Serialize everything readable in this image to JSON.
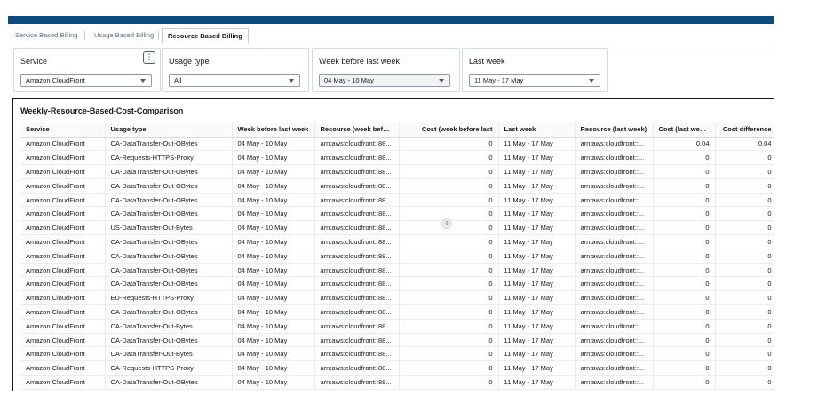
{
  "tabs": [
    {
      "label": "Service Based Billing",
      "active": false
    },
    {
      "label": "Usage Based Billing",
      "active": false
    },
    {
      "label": "Resource Based Billing",
      "active": true
    }
  ],
  "controls": {
    "service": {
      "label": "Service",
      "value": "Amazon CloudFront"
    },
    "usage_type": {
      "label": "Usage type",
      "value": "All"
    },
    "week_before": {
      "label": "Week before last week",
      "value": "04 May - 10 May"
    },
    "last_week": {
      "label": "Last week",
      "value": "11 May - 17 May"
    },
    "kebab_icon": "more-options-icon"
  },
  "table": {
    "title": "Weekly-Resource-Based-Cost-Comparison",
    "columns": [
      "Service",
      "Usage type",
      "Week before last week",
      "Resource (week befor...",
      "Cost (week before last",
      "Last week",
      "Resource (last week)",
      "Cost (last week)",
      "Cost difference"
    ],
    "scroll_bubble": "0",
    "rows": [
      [
        "Amazon CloudFront",
        "CA-DataTransfer-Out-OBytes",
        "04 May - 10 May",
        "arn:aws:cloudfront::88...",
        "0",
        "11 May - 17 May",
        "arn:aws:cloudfront::...",
        "0.04",
        "0.04"
      ],
      [
        "Amazon CloudFront",
        "CA-Requests-HTTPS-Proxy",
        "04 May - 10 May",
        "arn:aws:cloudfront::88...",
        "0",
        "11 May - 17 May",
        "arn:aws:cloudfront::...",
        "0",
        "0"
      ],
      [
        "Amazon CloudFront",
        "CA-DataTransfer-Out-OBytes",
        "04 May - 10 May",
        "arn:aws:cloudfront::88...",
        "0",
        "11 May - 17 May",
        "arn:aws:cloudfront::...",
        "0",
        "0"
      ],
      [
        "Amazon CloudFront",
        "CA-DataTransfer-Out-OBytes",
        "04 May - 10 May",
        "arn:aws:cloudfront::88...",
        "0",
        "11 May - 17 May",
        "arn:aws:cloudfront::...",
        "0",
        "0"
      ],
      [
        "Amazon CloudFront",
        "CA-DataTransfer-Out-OBytes",
        "04 May - 10 May",
        "arn:aws:cloudfront::88...",
        "0",
        "11 May - 17 May",
        "arn:aws:cloudfront::...",
        "0",
        "0"
      ],
      [
        "Amazon CloudFront",
        "CA-DataTransfer-Out-OBytes",
        "04 May - 10 May",
        "arn:aws:cloudfront::88...",
        "0",
        "11 May - 17 May",
        "arn:aws:cloudfront::...",
        "0",
        "0"
      ],
      [
        "Amazon CloudFront",
        "US-DataTransfer-Out-Bytes",
        "04 May - 10 May",
        "arn:aws:cloudfront::88...",
        "0",
        "11 May - 17 May",
        "arn:aws:cloudfront::...",
        "0",
        "0"
      ],
      [
        "Amazon CloudFront",
        "CA-DataTransfer-Out-OBytes",
        "04 May - 10 May",
        "arn:aws:cloudfront::88...",
        "0",
        "11 May - 17 May",
        "arn:aws:cloudfront::...",
        "0",
        "0"
      ],
      [
        "Amazon CloudFront",
        "CA-DataTransfer-Out-OBytes",
        "04 May - 10 May",
        "arn:aws:cloudfront::88...",
        "0",
        "11 May - 17 May",
        "arn:aws:cloudfront::...",
        "0",
        "0"
      ],
      [
        "Amazon CloudFront",
        "CA-DataTransfer-Out-OBytes",
        "04 May - 10 May",
        "arn:aws:cloudfront::88...",
        "0",
        "11 May - 17 May",
        "arn:aws:cloudfront::...",
        "0",
        "0"
      ],
      [
        "Amazon CloudFront",
        "CA-DataTransfer-Out-OBytes",
        "04 May - 10 May",
        "arn:aws:cloudfront::88...",
        "0",
        "11 May - 17 May",
        "arn:aws:cloudfront::...",
        "0",
        "0"
      ],
      [
        "Amazon CloudFront",
        "EU-Requests-HTTPS-Proxy",
        "04 May - 10 May",
        "arn:aws:cloudfront::88...",
        "0",
        "11 May - 17 May",
        "arn:aws:cloudfront::...",
        "0",
        "0"
      ],
      [
        "Amazon CloudFront",
        "CA-DataTransfer-Out-OBytes",
        "04 May - 10 May",
        "arn:aws:cloudfront::88...",
        "0",
        "11 May - 17 May",
        "arn:aws:cloudfront::...",
        "0",
        "0"
      ],
      [
        "Amazon CloudFront",
        "CA-DataTransfer-Out-Bytes",
        "04 May - 10 May",
        "arn:aws:cloudfront::88...",
        "0",
        "11 May - 17 May",
        "arn:aws:cloudfront::...",
        "0",
        "0"
      ],
      [
        "Amazon CloudFront",
        "CA-DataTransfer-Out-OBytes",
        "04 May - 10 May",
        "arn:aws:cloudfront::88...",
        "0",
        "11 May - 17 May",
        "arn:aws:cloudfront::...",
        "0",
        "0"
      ],
      [
        "Amazon CloudFront",
        "CA-DataTransfer-Out-Bytes",
        "04 May - 10 May",
        "arn:aws:cloudfront::88...",
        "0",
        "11 May - 17 May",
        "arn:aws:cloudfront::...",
        "0",
        "0"
      ],
      [
        "Amazon CloudFront",
        "CA-Requests-HTTPS-Proxy",
        "04 May - 10 May",
        "arn:aws:cloudfront::88...",
        "0",
        "11 May - 17 May",
        "arn:aws:cloudfront::...",
        "0",
        "0"
      ],
      [
        "Amazon CloudFront",
        "CA-DataTransfer-Out-OBytes",
        "04 May - 10 May",
        "arn:aws:cloudfront::88...",
        "0",
        "11 May - 17 May",
        "arn:aws:cloudfront::...",
        "0",
        "0"
      ]
    ]
  },
  "colors": {
    "topbar": "#0f4a7c",
    "border": "#d5dbdb",
    "text": "#16191f"
  }
}
